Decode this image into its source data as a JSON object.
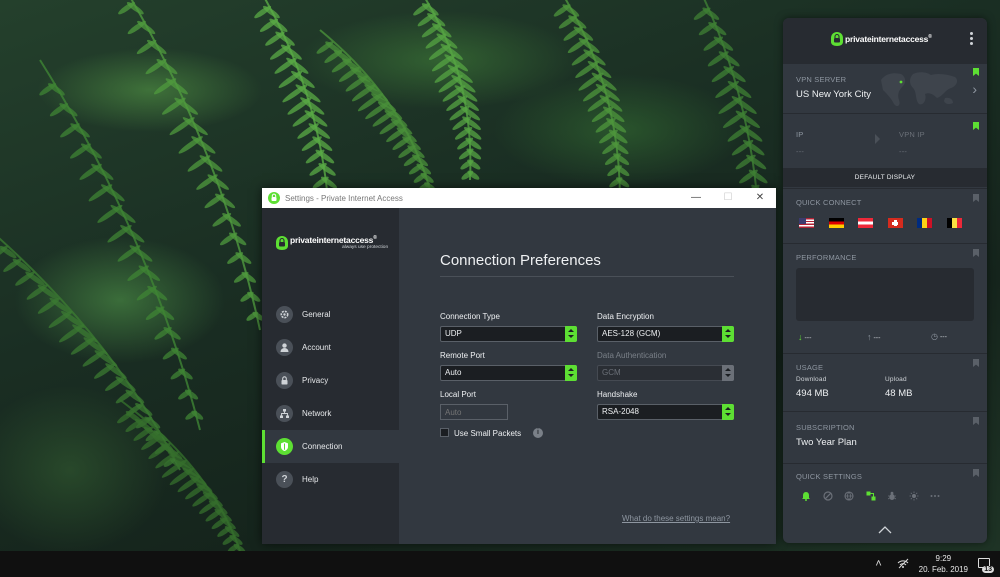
{
  "settings_window": {
    "title": "Settings - Private Internet Access",
    "brand": "privateinternetaccess",
    "tagline": "always use protection",
    "nav": [
      {
        "label": "General",
        "icon": "gear-icon"
      },
      {
        "label": "Account",
        "icon": "user-icon"
      },
      {
        "label": "Privacy",
        "icon": "lock-icon"
      },
      {
        "label": "Network",
        "icon": "network-icon"
      },
      {
        "label": "Connection",
        "icon": "shield-icon",
        "active": true
      },
      {
        "label": "Help",
        "icon": "question-icon"
      }
    ],
    "heading": "Connection Preferences",
    "connection_type": {
      "label": "Connection Type",
      "value": "UDP"
    },
    "remote_port": {
      "label": "Remote Port",
      "value": "Auto"
    },
    "local_port": {
      "label": "Local Port",
      "placeholder": "Auto"
    },
    "small_packets": {
      "label": "Use Small Packets",
      "checked": false
    },
    "data_encryption": {
      "label": "Data Encryption",
      "value": "AES-128 (GCM)"
    },
    "data_authentication": {
      "label": "Data Authentication",
      "value": "GCM",
      "disabled": true
    },
    "handshake": {
      "label": "Handshake",
      "value": "RSA-2048"
    },
    "help_link": "What do these settings mean?"
  },
  "pia_panel": {
    "brand": "privateinternetaccess",
    "vpn_server": {
      "label": "VPN SERVER",
      "value": "US New York City"
    },
    "ip": {
      "label": "IP",
      "value": "---"
    },
    "vpn_ip": {
      "label": "VPN IP",
      "value": "---"
    },
    "default_display": "DEFAULT DISPLAY",
    "quick_connect": {
      "label": "QUICK CONNECT",
      "flags": [
        "us-flag",
        "de-flag",
        "at-flag",
        "ch-flag",
        "ro-flag",
        "be-flag"
      ]
    },
    "performance": {
      "label": "PERFORMANCE",
      "download": "---",
      "upload": "---",
      "duration": "---"
    },
    "usage": {
      "label": "USAGE",
      "download_label": "Download",
      "download": "494 MB",
      "upload_label": "Upload",
      "upload": "48 MB"
    },
    "subscription": {
      "label": "SUBSCRIPTION",
      "value": "Two Year Plan"
    },
    "quick_settings": {
      "label": "QUICK SETTINGS"
    }
  },
  "taskbar": {
    "time": "9:29",
    "date": "20. Feb. 2019",
    "notifications": "13"
  },
  "colors": {
    "accent": "#5ddf33",
    "panel_bg": "#323840",
    "sidebar_bg": "#272b31"
  }
}
